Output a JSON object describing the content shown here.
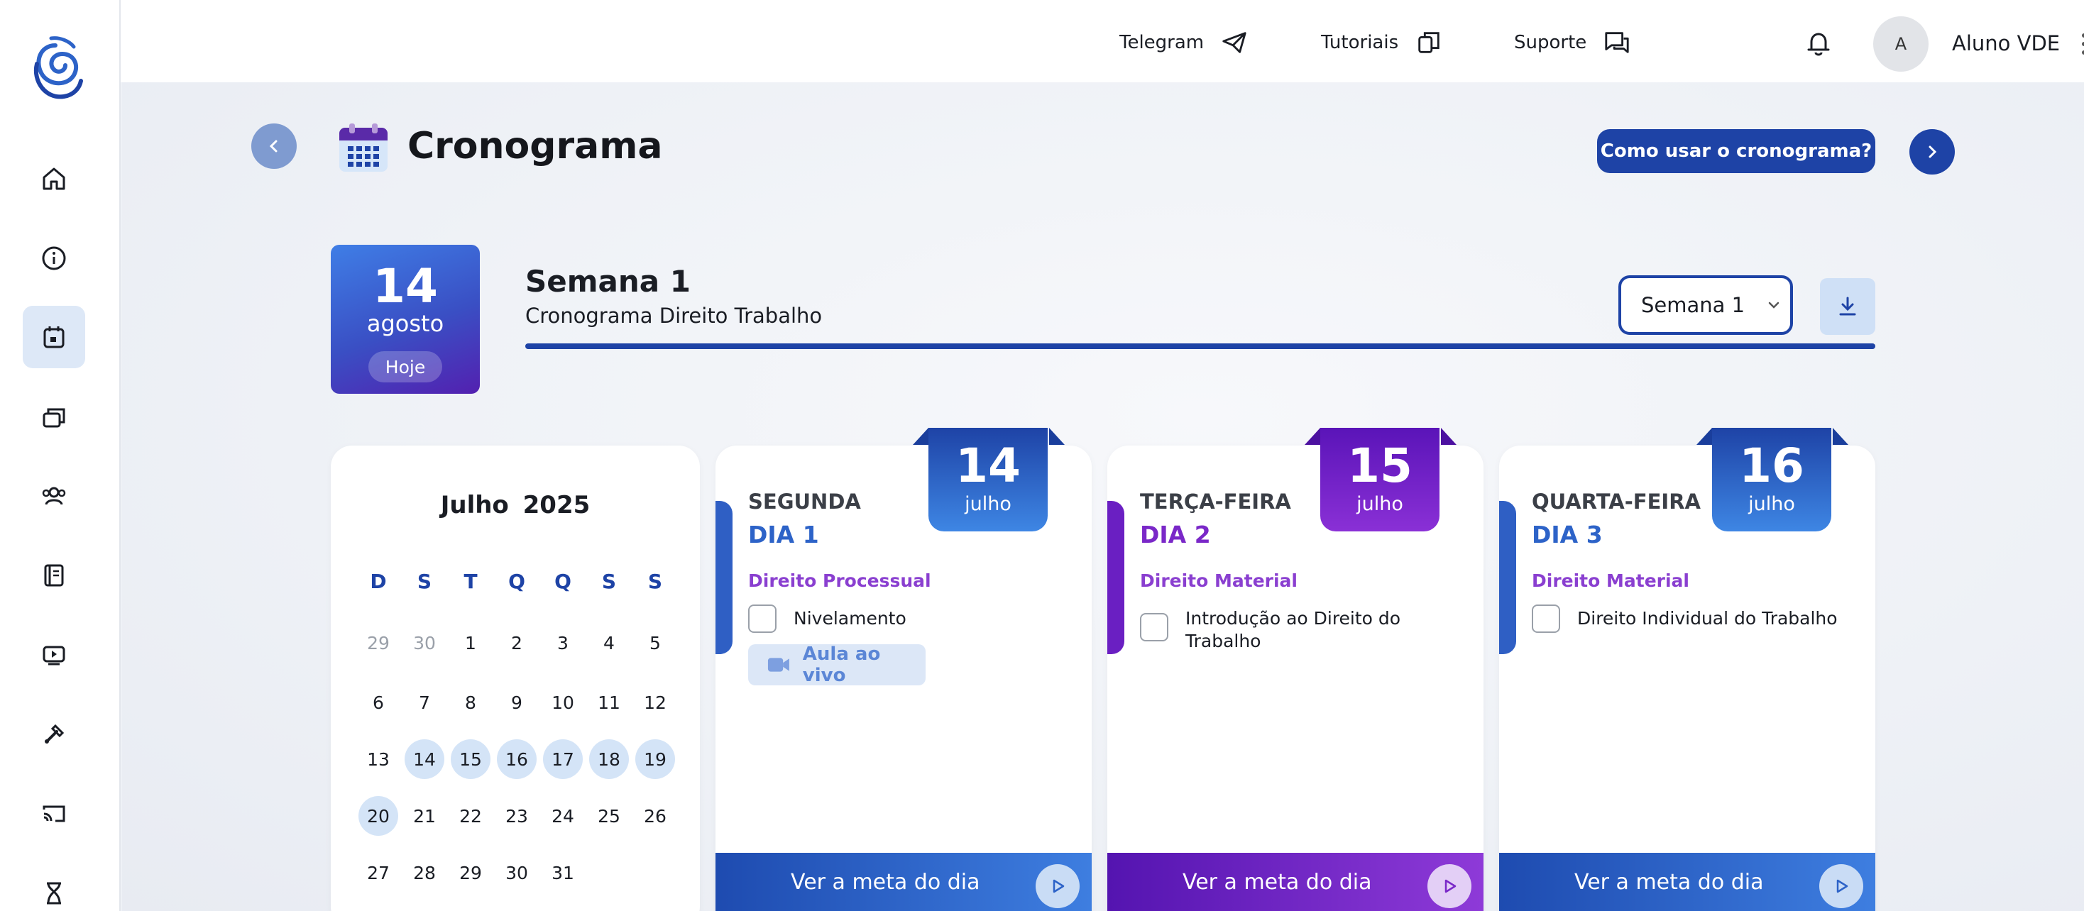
{
  "topbar": {
    "telegram": "Telegram",
    "tutorials": "Tutoriais",
    "support": "Suporte",
    "avatar_initial": "A",
    "user_name": "Aluno VDE"
  },
  "header": {
    "title": "Cronograma",
    "help_button": "Como usar o cronograma?"
  },
  "today": {
    "day": "14",
    "month": "agosto",
    "badge": "Hoje"
  },
  "week": {
    "title": "Semana 1",
    "subtitle": "Cronograma Direito Trabalho",
    "selected": "Semana 1"
  },
  "calendar": {
    "month": "Julho",
    "year": "2025",
    "weekdays": [
      "D",
      "S",
      "T",
      "Q",
      "Q",
      "S",
      "S"
    ],
    "rows": [
      [
        "29",
        "30",
        "1",
        "2",
        "3",
        "4",
        "5"
      ],
      [
        "6",
        "7",
        "8",
        "9",
        "10",
        "11",
        "12"
      ],
      [
        "13",
        "14",
        "15",
        "16",
        "17",
        "18",
        "19"
      ],
      [
        "20",
        "21",
        "22",
        "23",
        "24",
        "25",
        "26"
      ],
      [
        "27",
        "28",
        "29",
        "30",
        "31"
      ]
    ],
    "muted": [
      "0-0",
      "0-1"
    ],
    "highlighted": [
      "2-1",
      "2-2",
      "2-3",
      "2-4",
      "2-5",
      "2-6",
      "3-0"
    ]
  },
  "days": [
    {
      "weekday": "SEGUNDA",
      "label": "DIA 1",
      "date": "14",
      "month": "julho",
      "subject": "Direito Processual",
      "task": "Nivelamento",
      "live": "Aula ao vivo",
      "footer": "Ver a meta do dia"
    },
    {
      "weekday": "TERÇA-FEIRA",
      "label": "DIA 2",
      "date": "15",
      "month": "julho",
      "subject": "Direito Material",
      "task": "Introdução ao Direito do Trabalho",
      "footer": "Ver a meta do dia"
    },
    {
      "weekday": "QUARTA-FEIRA",
      "label": "DIA 3",
      "date": "16",
      "month": "julho",
      "subject": "Direito Material",
      "task": "Direito Individual do Trabalho",
      "footer": "Ver a meta do dia"
    }
  ],
  "icons": {
    "sidebar": [
      "home-icon",
      "info-icon",
      "calendar-icon",
      "folders-icon",
      "users-icon",
      "notebook-icon",
      "video-icon",
      "tools-icon",
      "cast-icon",
      "hourglass-icon"
    ]
  },
  "colors": {
    "primary": "#1e43a6",
    "purple": "#6a1fc2",
    "light_blue": "#d4e4f7"
  }
}
